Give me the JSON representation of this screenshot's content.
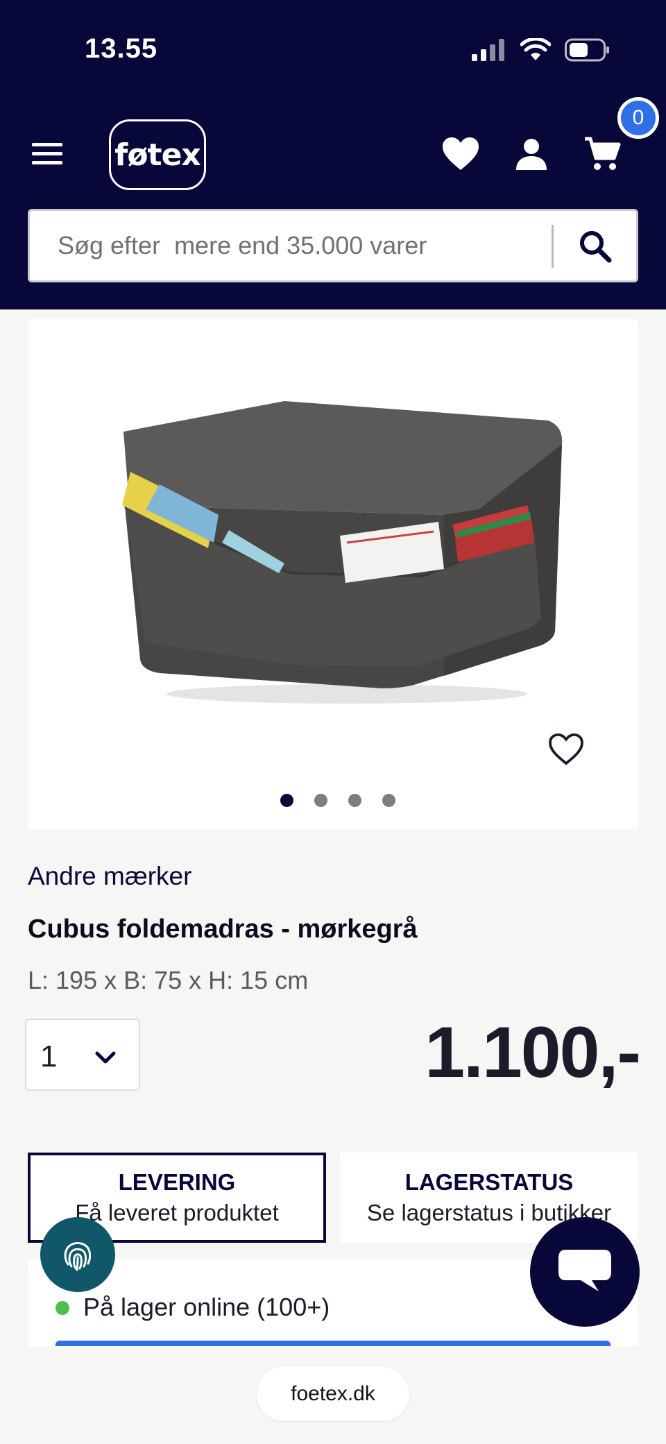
{
  "status_bar": {
    "time": "13.55"
  },
  "header": {
    "logo_text": "føtex",
    "cart_count": "0",
    "icons": [
      "menu-icon",
      "heart-icon",
      "user-icon",
      "cart-icon"
    ]
  },
  "search": {
    "placeholder": "Søg efter  mere end 35.000 varer",
    "value": ""
  },
  "gallery": {
    "image_count": 4,
    "active_index": 0
  },
  "product": {
    "brand": "Andre mærker",
    "title": "Cubus foldemadras - mørkegrå",
    "dimensions": "L: 195 x B: 75 x H: 15 cm",
    "quantity": "1",
    "price": "1.100,-"
  },
  "tabs": [
    {
      "title": "LEVERING",
      "subtitle": "Få leveret produktet"
    },
    {
      "title": "LAGERSTATUS",
      "subtitle": "Se lagerstatus i butikker"
    }
  ],
  "stock": {
    "status": "På lager online (100+)"
  },
  "browser": {
    "url": "foetex.dk"
  },
  "colors": {
    "header_bg": "#070739",
    "accent_blue": "#2f6fe8",
    "stock_green": "#4cc04f",
    "fingerprint_bg": "#11576a"
  }
}
